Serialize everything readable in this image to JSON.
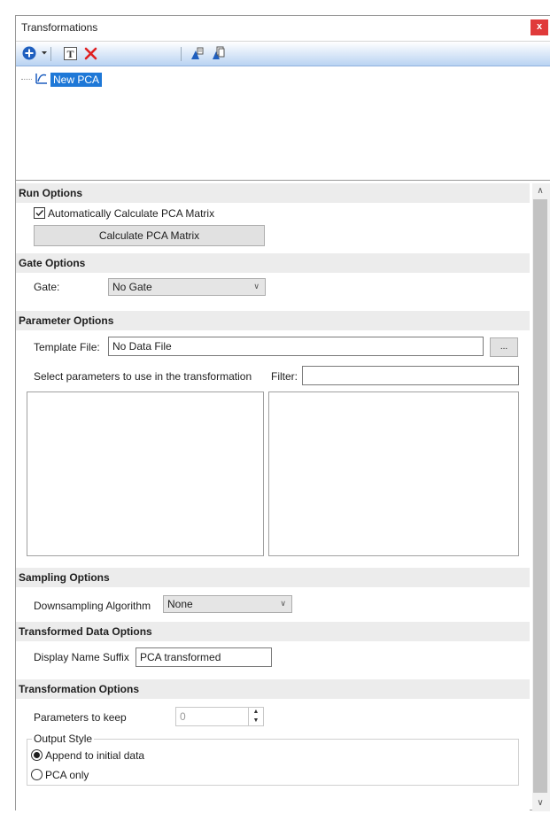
{
  "window": {
    "title": "Transformations",
    "close_glyph": "x"
  },
  "toolbar": {
    "icons": [
      "add-icon",
      "dropdown-arrow-icon",
      "rename-icon",
      "delete-icon",
      "apply-icon",
      "copy-icon"
    ]
  },
  "tree": {
    "item_label": "New PCA"
  },
  "run_options": {
    "header": "Run Options",
    "auto_calc_label": "Automatically Calculate PCA Matrix",
    "auto_calc_checked": true,
    "calc_button": "Calculate PCA Matrix"
  },
  "gate_options": {
    "header": "Gate Options",
    "gate_label": "Gate:",
    "gate_value": "No Gate"
  },
  "parameter_options": {
    "header": "Parameter Options",
    "template_label": "Template File:",
    "template_value": "No Data File",
    "browse_button": "...",
    "select_label": "Select parameters to use in the transformation",
    "filter_label": "Filter:",
    "filter_value": ""
  },
  "sampling_options": {
    "header": "Sampling Options",
    "algorithm_label": "Downsampling Algorithm",
    "algorithm_value": "None"
  },
  "transformed_data_options": {
    "header": "Transformed Data Options",
    "suffix_label": "Display Name Suffix",
    "suffix_value": "PCA transformed"
  },
  "transformation_options": {
    "header": "Transformation Options",
    "keep_label": "Parameters to keep",
    "keep_value": "0",
    "output_style_label": "Output Style",
    "radio_append": "Append to initial data",
    "radio_pca_only": "PCA only",
    "selected": "append"
  }
}
